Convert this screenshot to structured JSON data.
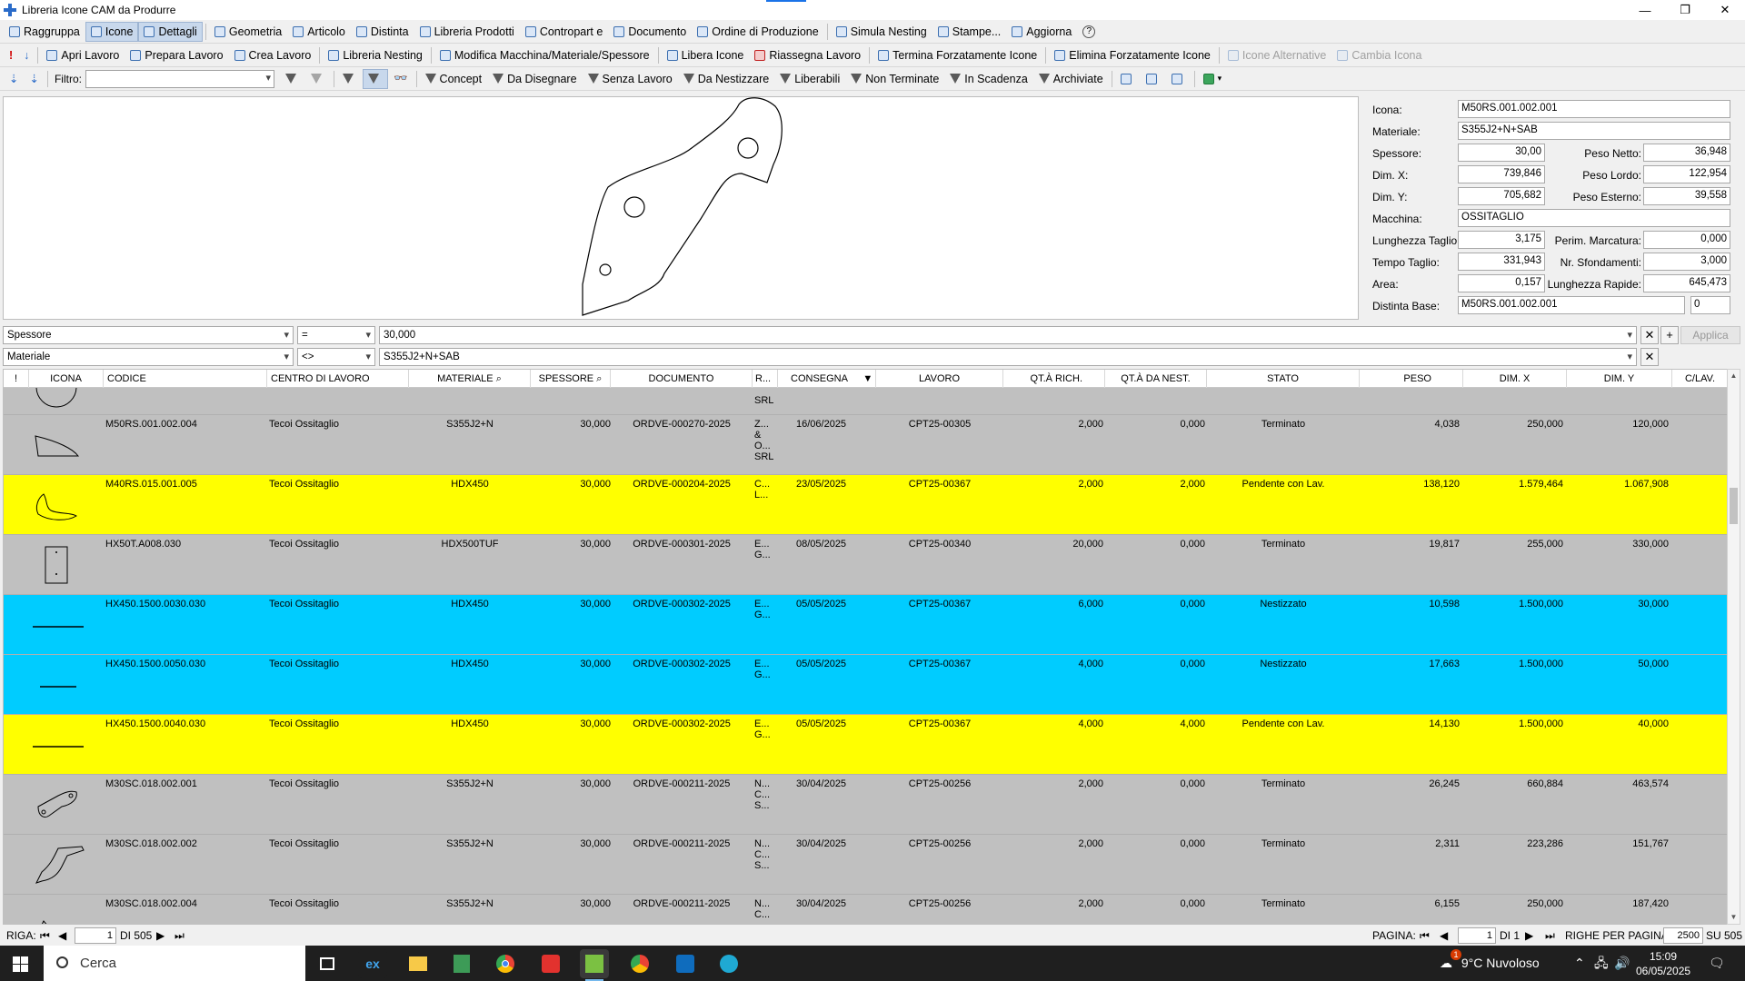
{
  "window": {
    "title": "Libreria Icone CAM da Produrre",
    "minimize": "—",
    "maximize": "❐",
    "close": "✕"
  },
  "toolbar1": {
    "raggruppa": "Raggruppa",
    "icone": "Icone",
    "dettagli": "Dettagli",
    "geometria": "Geometria",
    "articolo": "Articolo",
    "distinta": "Distinta",
    "libreria_prodotti": "Libreria Prodotti",
    "contropart": "Contropart e",
    "documento": "Documento",
    "ordine_produzione": "Ordine di Produzione",
    "simula_nesting": "Simula Nesting",
    "stampe": "Stampe...",
    "aggiorna": "Aggiorna",
    "help": "?"
  },
  "toolbar2": {
    "apri_lavoro": "Apri Lavoro",
    "prepara_lavoro": "Prepara Lavoro",
    "crea_lavoro": "Crea Lavoro",
    "libreria_nesting": "Libreria Nesting",
    "modifica": "Modifica Macchina/Materiale/Spessore",
    "libera_icone": "Libera Icone",
    "riassegna_lavoro": "Riassegna Lavoro",
    "termina_forzatamente": "Termina Forzatamente Icone",
    "elimina_forzatamente": "Elimina Forzatamente Icone",
    "icone_alternative": "Icone Alternative",
    "cambia_icona": "Cambia Icona"
  },
  "toolbar3": {
    "filtro_label": "Filtro:",
    "filtro_value": "",
    "concept": "Concept",
    "da_disegnare": "Da Disegnare",
    "senza_lavoro": "Senza Lavoro",
    "da_nestizzare": "Da Nestizzare",
    "liberabili": "Liberabili",
    "non_terminate": "Non Terminate",
    "in_scadenza": "In Scadenza",
    "archiviate": "Archiviate"
  },
  "detail": {
    "icona_label": "Icona:",
    "icona": "M50RS.001.002.001",
    "materiale_label": "Materiale:",
    "materiale": "S355J2+N+SAB",
    "spessore_label": "Spessore:",
    "spessore": "30,00",
    "peso_netto_label": "Peso Netto:",
    "peso_netto": "36,948",
    "dimx_label": "Dim. X:",
    "dimx": "739,846",
    "peso_lordo_label": "Peso Lordo:",
    "peso_lordo": "122,954",
    "dimy_label": "Dim. Y:",
    "dimy": "705,682",
    "peso_esterno_label": "Peso Esterno:",
    "peso_esterno": "39,558",
    "macchina_label": "Macchina:",
    "macchina": "OSSITAGLIO",
    "lungh_taglio_label": "Lunghezza Taglio:",
    "lungh_taglio": "3,175",
    "perim_marc_label": "Perim. Marcatura:",
    "perim_marc": "0,000",
    "tempo_taglio_label": "Tempo Taglio:",
    "tempo_taglio": "331,943",
    "nr_sfond_label": "Nr. Sfondamenti:",
    "nr_sfond": "3,000",
    "area_label": "Area:",
    "area": "0,157",
    "lungh_rapide_label": "Lunghezza Rapide:",
    "lungh_rapide": "645,473",
    "distinta_base_label": "Distinta Base:",
    "distinta_base": "M50RS.001.002.001",
    "distinta_base_num": "0"
  },
  "conditions": [
    {
      "field": "Spessore",
      "op": "=",
      "value": "30,000"
    },
    {
      "field": "Materiale",
      "op": "<>",
      "value": "S355J2+N+SAB"
    }
  ],
  "apply_label": "Applica",
  "grid": {
    "headers": {
      "flag": "!",
      "icona": "ICONA",
      "codice": "CODICE",
      "centro": "CENTRO DI LAVORO",
      "materiale": "MATERIALE",
      "spessore": "SPESSORE",
      "documento": "DOCUMENTO",
      "r": "R...",
      "consegna": "CONSEGNA",
      "lavoro": "LAVORO",
      "qt_rich": "QT.À RICH.",
      "qt_nest": "QT.À DA NEST.",
      "stato": "STATO",
      "peso": "PESO",
      "dimx": "DIM. X",
      "dimy": "DIM. Y",
      "clav": "C/LAV."
    },
    "partial_row": {
      "r": "SRL"
    },
    "rows": [
      {
        "codice": "M50RS.001.002.004",
        "centro": "Tecoi Ossitaglio",
        "materiale": "S355J2+N",
        "spessore": "30,000",
        "documento": "ORDVE-000270-2025",
        "r": "Z... & O... SRL",
        "consegna": "16/06/2025",
        "lavoro": "CPT25-00305",
        "qt_rich": "2,000",
        "qt_nest": "0,000",
        "stato": "Terminato",
        "peso": "4,038",
        "dimx": "250,000",
        "dimy": "120,000",
        "color": "#c0c0c0"
      },
      {
        "codice": "M40RS.015.001.005",
        "centro": "Tecoi Ossitaglio",
        "materiale": "HDX450",
        "spessore": "30,000",
        "documento": "ORDVE-000204-2025",
        "r": "C... L...",
        "consegna": "23/05/2025",
        "lavoro": "CPT25-00367",
        "qt_rich": "2,000",
        "qt_nest": "2,000",
        "stato": "Pendente con Lav.",
        "peso": "138,120",
        "dimx": "1.579,464",
        "dimy": "1.067,908",
        "color": "#ffff00"
      },
      {
        "codice": "HX50T.A008.030",
        "centro": "Tecoi Ossitaglio",
        "materiale": "HDX500TUF",
        "spessore": "30,000",
        "documento": "ORDVE-000301-2025",
        "r": "E... G...",
        "consegna": "08/05/2025",
        "lavoro": "CPT25-00340",
        "qt_rich": "20,000",
        "qt_nest": "0,000",
        "stato": "Terminato",
        "peso": "19,817",
        "dimx": "255,000",
        "dimy": "330,000",
        "color": "#c0c0c0"
      },
      {
        "codice": "HX450.1500.0030.030",
        "centro": "Tecoi Ossitaglio",
        "materiale": "HDX450",
        "spessore": "30,000",
        "documento": "ORDVE-000302-2025",
        "r": "E... G...",
        "consegna": "05/05/2025",
        "lavoro": "CPT25-00367",
        "qt_rich": "6,000",
        "qt_nest": "0,000",
        "stato": "Nestizzato",
        "peso": "10,598",
        "dimx": "1.500,000",
        "dimy": "30,000",
        "color": "#00ccff"
      },
      {
        "codice": "HX450.1500.0050.030",
        "centro": "Tecoi Ossitaglio",
        "materiale": "HDX450",
        "spessore": "30,000",
        "documento": "ORDVE-000302-2025",
        "r": "E... G...",
        "consegna": "05/05/2025",
        "lavoro": "CPT25-00367",
        "qt_rich": "4,000",
        "qt_nest": "0,000",
        "stato": "Nestizzato",
        "peso": "17,663",
        "dimx": "1.500,000",
        "dimy": "50,000",
        "color": "#00ccff"
      },
      {
        "codice": "HX450.1500.0040.030",
        "centro": "Tecoi Ossitaglio",
        "materiale": "HDX450",
        "spessore": "30,000",
        "documento": "ORDVE-000302-2025",
        "r": "E... G...",
        "consegna": "05/05/2025",
        "lavoro": "CPT25-00367",
        "qt_rich": "4,000",
        "qt_nest": "4,000",
        "stato": "Pendente con Lav.",
        "peso": "14,130",
        "dimx": "1.500,000",
        "dimy": "40,000",
        "color": "#ffff00"
      },
      {
        "codice": "M30SC.018.002.001",
        "centro": "Tecoi Ossitaglio",
        "materiale": "S355J2+N",
        "spessore": "30,000",
        "documento": "ORDVE-000211-2025",
        "r": "N... C... S...",
        "consegna": "30/04/2025",
        "lavoro": "CPT25-00256",
        "qt_rich": "2,000",
        "qt_nest": "0,000",
        "stato": "Terminato",
        "peso": "26,245",
        "dimx": "660,884",
        "dimy": "463,574",
        "color": "#c0c0c0"
      },
      {
        "codice": "M30SC.018.002.002",
        "centro": "Tecoi Ossitaglio",
        "materiale": "S355J2+N",
        "spessore": "30,000",
        "documento": "ORDVE-000211-2025",
        "r": "N... C... S...",
        "consegna": "30/04/2025",
        "lavoro": "CPT25-00256",
        "qt_rich": "2,000",
        "qt_nest": "0,000",
        "stato": "Terminato",
        "peso": "2,311",
        "dimx": "223,286",
        "dimy": "151,767",
        "color": "#c0c0c0"
      },
      {
        "codice": "M30SC.018.002.004",
        "centro": "Tecoi Ossitaglio",
        "materiale": "S355J2+N",
        "spessore": "30,000",
        "documento": "ORDVE-000211-2025",
        "r": "N... C...",
        "consegna": "30/04/2025",
        "lavoro": "CPT25-00256",
        "qt_rich": "2,000",
        "qt_nest": "0,000",
        "stato": "Terminato",
        "peso": "6,155",
        "dimx": "250,000",
        "dimy": "187,420",
        "color": "#c0c0c0"
      }
    ]
  },
  "status": {
    "riga_label": "RIGA:",
    "riga_value": "1",
    "riga_of": "DI 505",
    "pagina_label": "PAGINA:",
    "pagina_value": "1",
    "pagina_of": "DI 1",
    "righe_label": "RIGHE PER PAGINA:",
    "righe_value": "2500",
    "righe_of": "SU 505"
  },
  "taskbar": {
    "search_placeholder": "Cerca",
    "weather": "9°C  Nuvoloso",
    "time": "15:09",
    "date": "06/05/2025",
    "notify_badge": "1"
  }
}
